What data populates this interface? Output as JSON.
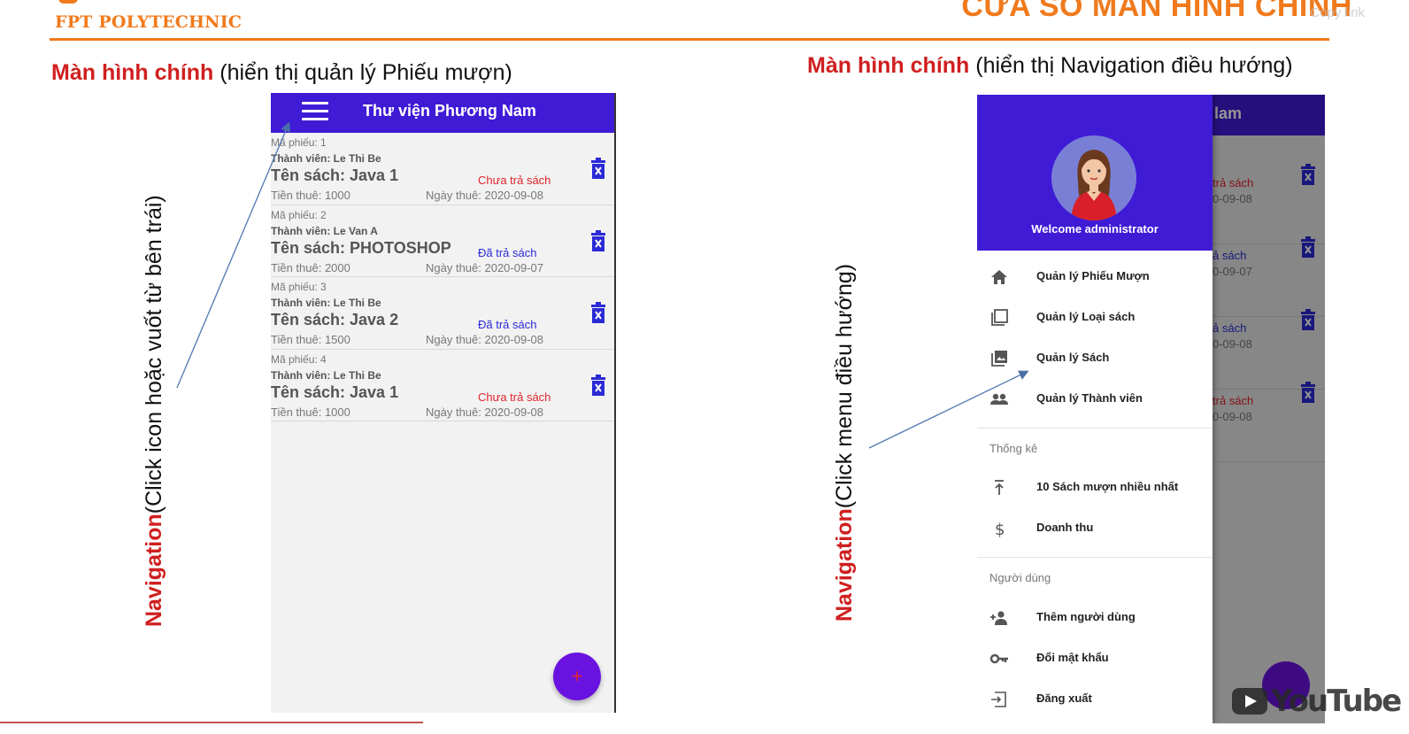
{
  "header": {
    "logo_text": "FPT POLYTECHNIC",
    "slide_title": "CỬA SỔ MÀN HÌNH CHÍNH",
    "copy_link": "Copy link"
  },
  "left_section": {
    "title_highlight": "Màn hình chính",
    "title_rest": " (hiển thị quản lý Phiếu mượn)",
    "note_highlight": "Navigation",
    "note_rest": "(Click icon hoặc vuốt từ bên trái)"
  },
  "right_section": {
    "title_highlight": "Màn hình chính",
    "title_rest": " (hiển thị Navigation điều hướng)",
    "note_highlight": "Navigation",
    "note_rest": "(Click menu điều hướng)"
  },
  "app": {
    "title": "Thư viện Phương Nam",
    "loans": [
      {
        "ma": "Mã phiếu: 1",
        "thanh_vien": "Thành viên: Le Thi Be",
        "ten_sach": "Tên sách: Java 1",
        "status": "Chưa trả sách",
        "status_type": "red",
        "tien": "Tiền thuê: 1000",
        "ngay": "Ngày thuê: 2020-09-08"
      },
      {
        "ma": "Mã phiếu: 2",
        "thanh_vien": "Thành viên: Le Van A",
        "ten_sach": "Tên sách: PHOTOSHOP",
        "status": "Đã trả sách",
        "status_type": "blue",
        "tien": "Tiền thuê: 2000",
        "ngay": "Ngày thuê: 2020-09-07"
      },
      {
        "ma": "Mã phiếu: 3",
        "thanh_vien": "Thành viên: Le Thi Be",
        "ten_sach": "Tên sách: Java 2",
        "status": "Đã trả sách",
        "status_type": "blue",
        "tien": "Tiền thuê: 1500",
        "ngay": "Ngày thuê: 2020-09-08"
      },
      {
        "ma": "Mã phiếu: 4",
        "thanh_vien": "Thành viên: Le Thi Be",
        "ten_sach": "Tên sách: Java 1",
        "status": "Chưa trả sách",
        "status_type": "red",
        "tien": "Tiền thuê: 1000",
        "ngay": "Ngày thuê: 2020-09-08"
      }
    ],
    "fab_label": "+"
  },
  "behind": {
    "title_fragment": "lam",
    "rows": [
      {
        "status": "trả sách",
        "status_type": "red",
        "date": "0-09-08"
      },
      {
        "status": "ả sách",
        "status_type": "blue",
        "date": "0-09-07"
      },
      {
        "status": "ả sách",
        "status_type": "blue",
        "date": "0-09-08"
      },
      {
        "status": "trả sách",
        "status_type": "red",
        "date": "0-09-08"
      }
    ]
  },
  "drawer": {
    "welcome": "Welcome administrator",
    "items_main": [
      {
        "label": "Quản lý Phiếu Mượn",
        "icon": "home-icon"
      },
      {
        "label": "Quản lý Loại sách",
        "icon": "collection-icon"
      },
      {
        "label": "Quản lý Sách",
        "icon": "image-library-icon"
      },
      {
        "label": "Quản lý Thành viên",
        "icon": "people-icon"
      }
    ],
    "group_stats": "Thống kê",
    "items_stats": [
      {
        "label": "10 Sách mượn nhiều nhất",
        "icon": "top-arrow-icon"
      },
      {
        "label": "Doanh thu",
        "icon": "dollar-icon"
      }
    ],
    "group_users": "Người dùng",
    "items_users": [
      {
        "label": "Thêm người dùng",
        "icon": "add-person-icon"
      },
      {
        "label": "Đổi mật khẩu",
        "icon": "key-icon"
      },
      {
        "label": "Đăng xuất",
        "icon": "logout-icon"
      }
    ]
  },
  "watermark": {
    "youtube": "YouTube"
  },
  "colors": {
    "accent": "#f07a1c",
    "appbar": "#3f1bd6",
    "fab": "#6a12e0",
    "red": "#e0242b",
    "blue": "#2a2ad6",
    "highlight": "#d01f1f"
  }
}
